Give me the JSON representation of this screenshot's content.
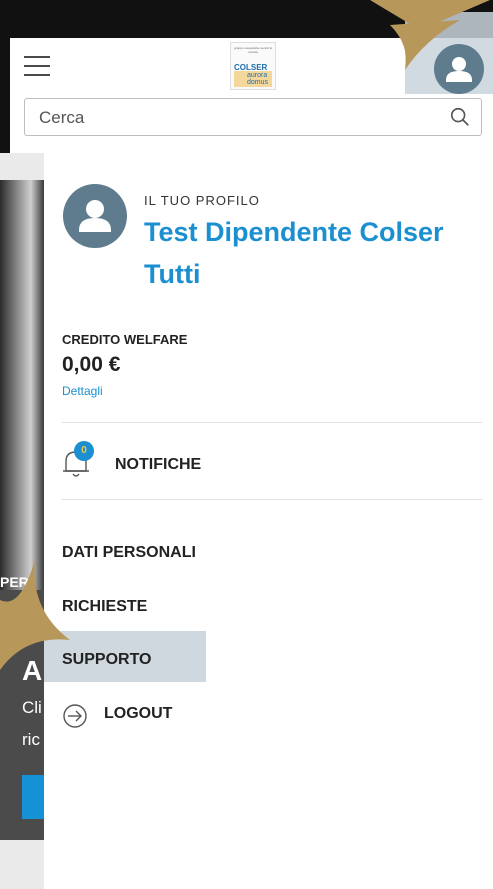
{
  "header": {
    "logo": {
      "top_text": "gruppo cooperativo servizi & società",
      "brand": "COLSER",
      "sub": "aurora domus"
    }
  },
  "search": {
    "placeholder": "Cerca"
  },
  "background_page": {
    "fragment_1": "PER",
    "fragment_2": "A",
    "fragment_3": "Cli",
    "fragment_4": "ric"
  },
  "drawer": {
    "profile_kicker": "IL TUO PROFILO",
    "user_name": "Test Dipendente Colser Tutti",
    "welfare": {
      "label": "CREDITO WELFARE",
      "amount": "0,00 €",
      "details_link": "Dettagli"
    },
    "notifications": {
      "label": "NOTIFICHE",
      "count": "0"
    },
    "menu": {
      "personal_data": "DATI PERSONALI",
      "requests": "RICHIESTE",
      "support": "SUPPORTO",
      "logout": "LOGOUT"
    }
  },
  "colors": {
    "accent": "#1b8fd0",
    "avatar": "#5f7c8f",
    "highlight": "#c9d4da",
    "gold": "#b8975a"
  },
  "icons": [
    "hamburger-icon",
    "user-icon",
    "search-icon",
    "bell-icon",
    "logout-icon"
  ]
}
